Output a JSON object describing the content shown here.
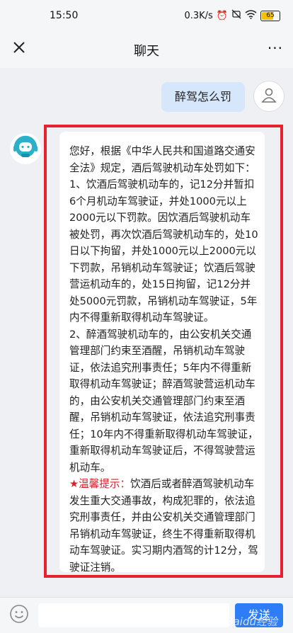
{
  "status_bar": {
    "time": "15:50",
    "network_speed": "0.3K/s",
    "battery": "65"
  },
  "header": {
    "title": "聊天",
    "more_label": "···"
  },
  "messages": {
    "user_text": "醉驾怎么罚",
    "bot_intro": "您好，根据《中华人民共和国道路交通安全法》规定，酒后驾驶机动车处罚如下：",
    "bot_item1": "1、饮酒后驾驶机动车的，记12分并暂扣6个月机动车驾驶证，并处1000元以上2000元以下罚款。因饮酒后驾驶机动车被处罚，再次饮酒后驾驶机动车的，处10日以下拘留，并处1000元以上2000元以下罚款，吊销机动车驾驶证；饮酒后驾驶营运机动车的，处15日拘留，记12分并处5000元罚款，吊销机动车驾驶证，5年内不得重新取得机动车驾驶证。",
    "bot_item2": "2、醉酒驾驶机动车的，由公安机关交通管理部门约束至酒醒，吊销机动车驾驶证，依法追究刑事责任；5年内不得重新取得机动车驾驶证；醉酒驾驶营运机动车的，由公安机关交通管理部门约束至酒醒，吊销机动车驾驶证，依法追究刑事责任；10年内不得重新取得机动车驾驶证，重新取得机动车驾驶证后，不得驾驶营运机动车。",
    "tip_label": "★温馨提示：",
    "tip_text": "饮酒后或者醉酒驾驶机动车发生重大交通事故，构成犯罪的，依法追究刑事责任，并由公安机关交通管理部门吊销机动车驾驶证，终生不得重新取得机动车驾驶证。实习期内酒驾的计12分，驾驶证注销。"
  },
  "input_bar": {
    "placeholder": "",
    "send_label": "发送"
  },
  "watermark": "Baidu经验",
  "colors": {
    "accent": "#2e7cf6",
    "highlight_frame": "#e8212f",
    "user_bubble": "#d6e6fb"
  }
}
